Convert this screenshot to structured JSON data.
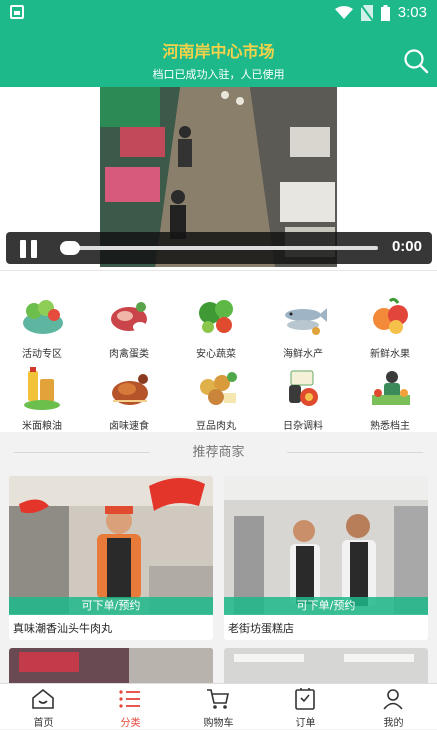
{
  "status_bar": {
    "time": "3:03"
  },
  "header": {
    "title": "河南岸中心市场",
    "subtitle": "档口已成功入驻，人已使用"
  },
  "video": {
    "time": "0:00",
    "progress_fraction": 0.0
  },
  "categories": [
    {
      "label": "活动专区",
      "icon": "vegetable-basket-icon"
    },
    {
      "label": "肉禽蛋类",
      "icon": "meat-icon"
    },
    {
      "label": "安心蔬菜",
      "icon": "vegetables-icon"
    },
    {
      "label": "海鲜水产",
      "icon": "fish-icon"
    },
    {
      "label": "新鲜水果",
      "icon": "fruit-icon"
    },
    {
      "label": "米面粮油",
      "icon": "grain-oil-icon"
    },
    {
      "label": "卤味速食",
      "icon": "braised-duck-icon"
    },
    {
      "label": "豆品肉丸",
      "icon": "tofu-meatball-icon"
    },
    {
      "label": "日杂调料",
      "icon": "seasoning-icon"
    },
    {
      "label": "熟悉档主",
      "icon": "stall-owner-icon"
    }
  ],
  "section": {
    "title": "推荐商家"
  },
  "shops": [
    {
      "name": "真味潮香汕头牛肉丸",
      "banner": "可下单/预约"
    },
    {
      "name": "老街坊蛋糕店",
      "banner": "可下单/预约"
    }
  ],
  "bottom_nav": [
    {
      "label": "首页",
      "icon": "home-icon"
    },
    {
      "label": "分类",
      "icon": "category-list-icon",
      "active": true
    },
    {
      "label": "购物车",
      "icon": "cart-icon"
    },
    {
      "label": "订单",
      "icon": "order-icon"
    },
    {
      "label": "我的",
      "icon": "profile-icon"
    }
  ],
  "colors": {
    "brand": "#1db98a",
    "title": "#f6d24a",
    "active": "#e6453a"
  }
}
